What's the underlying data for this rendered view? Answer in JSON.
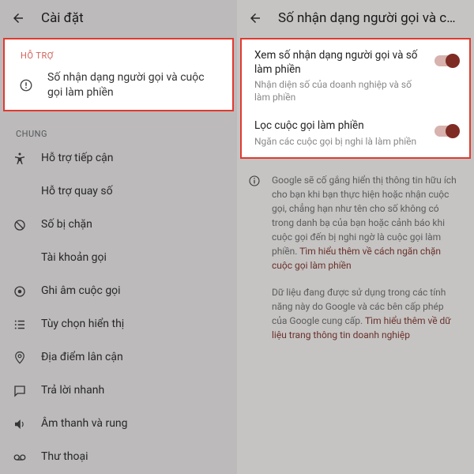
{
  "left": {
    "title": "Cài đặt",
    "support_label": "HỖ TRỢ",
    "support_item": "Số nhận dạng người gọi và cuộc gọi làm phiền",
    "general_label": "CHUNG",
    "items": {
      "accessibility": "Hỗ trợ tiếp cận",
      "dialpad": "Hỗ trợ quay số",
      "blocked": "Số bị chặn",
      "accounts": "Tài khoản gọi",
      "record": "Ghi âm cuộc gọi",
      "display": "Tùy chọn hiển thị",
      "nearby": "Địa điểm lân cận",
      "quickreply": "Trả lời nhanh",
      "sound": "Âm thanh và rung",
      "voicemail": "Thư thoại"
    }
  },
  "right": {
    "title": "Số nhận dạng người gọi và cuộ...",
    "toggle1": {
      "title": "Xem số nhận dạng người gọi và số làm phiền",
      "sub": "Nhận diện số của doanh nghiệp và số làm phiền"
    },
    "toggle2": {
      "title": "Lọc cuộc gọi làm phiền",
      "sub": "Ngăn các cuộc gọi bị nghi là làm phiền"
    },
    "info1a": "Google sẽ cố gắng hiển thị thông tin hữu ích cho bạn khi bạn thực hiện hoặc nhận cuộc gọi, chẳng hạn như tên cho số không có trong danh bạ của bạn hoặc cảnh báo khi cuộc gọi đến bị nghi ngờ là cuộc gọi làm phiền. ",
    "info1link": "Tìm hiểu thêm về cách ngăn chặn cuộc gọi làm phiền",
    "info2a": "Dữ liệu đang được sử dụng trong các tính năng này do Google và các bên cấp phép của Google cung cấp. ",
    "info2link": "Tìm hiểu thêm về dữ liệu trang thông tin doanh nghiệp"
  }
}
